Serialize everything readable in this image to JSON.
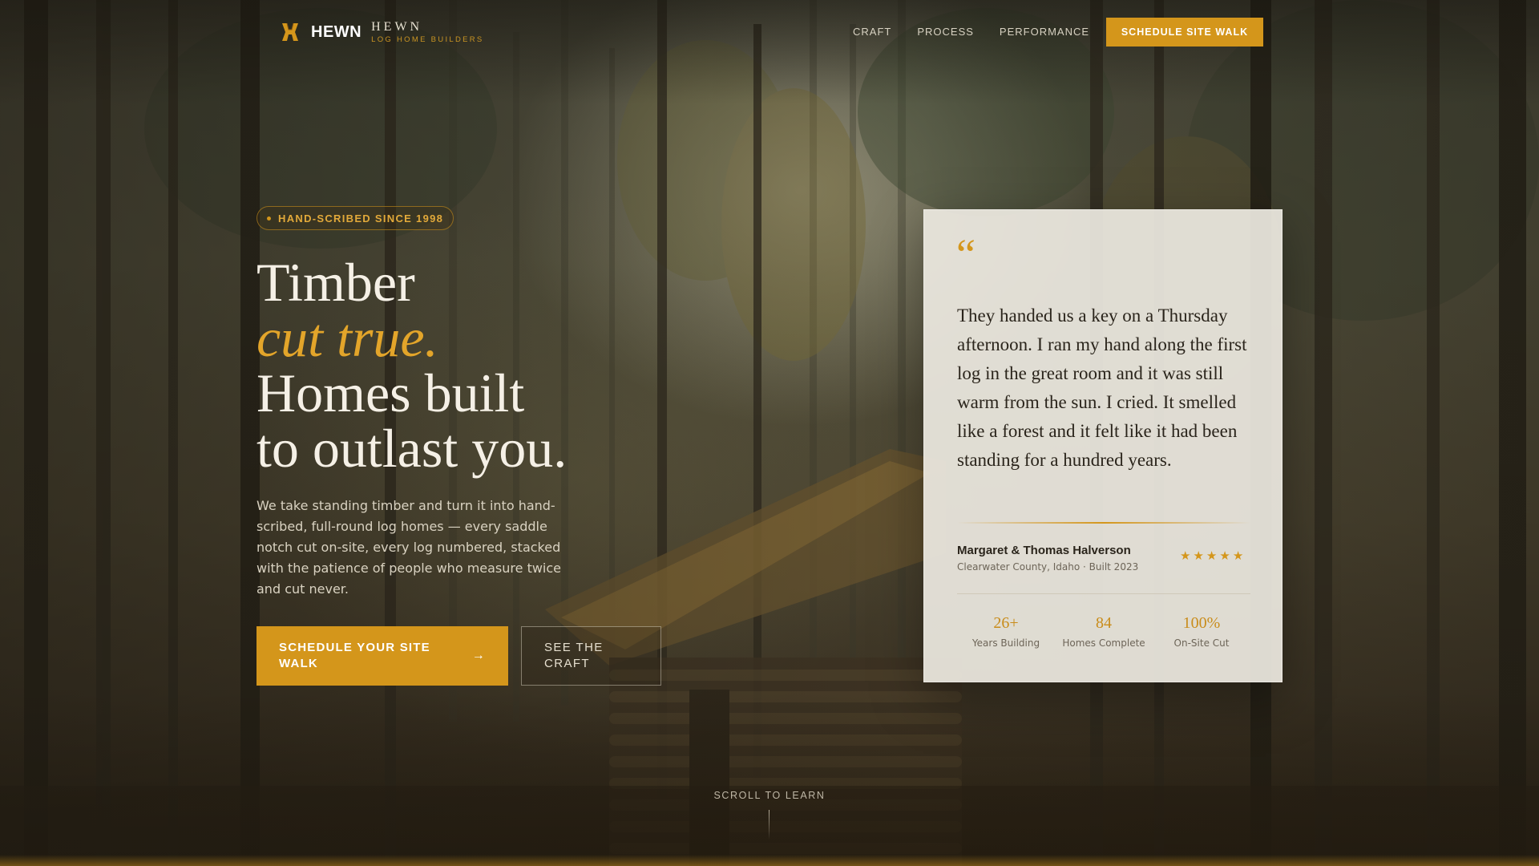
{
  "colors": {
    "accent": "#d4961b",
    "accent_text": "#e3a52a",
    "card_bg": "#ece8e0",
    "headline": "#f5f0e6"
  },
  "nav": {
    "brand_icon": "hewn-logo-icon",
    "brand_name": "HEWN",
    "brand_wordmark": "HEWN",
    "brand_tagline": "LOG HOME BUILDERS",
    "links": [
      "CRAFT",
      "PROCESS",
      "PERFORMANCE"
    ],
    "cta_label": "SCHEDULE SITE WALK"
  },
  "hero": {
    "badge": "HAND-SCRIBED SINCE 1998",
    "headline": {
      "line1": "Timber",
      "line2": "cut true.",
      "line3": "Homes built",
      "line4": "to outlast you."
    },
    "lede": "We take standing timber and turn it into hand-scribed, full-round log homes — every saddle notch cut on-site, every log numbered, stacked with the patience of people who measure twice and cut never.",
    "primary_cta": "SCHEDULE YOUR SITE WALK",
    "primary_cta_icon": "arrow-right-icon",
    "secondary_cta": "SEE THE CRAFT"
  },
  "testimonial": {
    "quote_mark": "“",
    "quote": "They handed us a key on a Thursday afternoon. I ran my hand along the first log in the great room and it was still warm from the sun. I cried. It smelled like a forest and it felt like it had been standing for a hundred years.",
    "author": "Margaret & Thomas Halverson",
    "meta": "Clearwater County, Idaho · Built 2023",
    "rating": 5,
    "stars": [
      "★",
      "★",
      "★",
      "★",
      "★"
    ],
    "stats": [
      {
        "value": "26+",
        "label": "Years Building"
      },
      {
        "value": "84",
        "label": "Homes Complete"
      },
      {
        "value": "100%",
        "label": "On-Site Cut"
      }
    ]
  },
  "scroll_cue": "SCROLL TO LEARN"
}
